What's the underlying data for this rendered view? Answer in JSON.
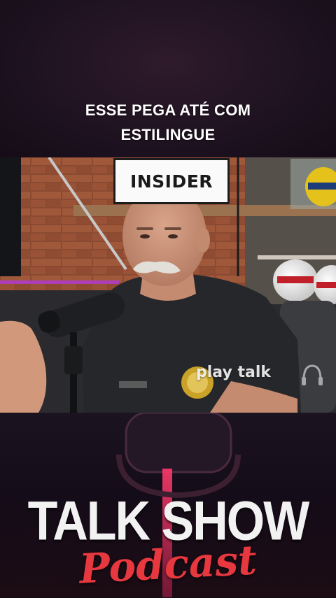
{
  "caption": {
    "line1": "ESSE PEGA ATÉ COM",
    "line2": "ESTILINGUE"
  },
  "video": {
    "studio_sign": "INSIDER",
    "watermark": "play talk",
    "icons": [
      "microphone-icon",
      "headphones-icon"
    ]
  },
  "branding": {
    "title": "TALK SHOW",
    "subtitle": "Podcast",
    "colors": {
      "title": "#f2f2f2",
      "subtitle": "#e8383f",
      "background": "#170f1c"
    }
  }
}
